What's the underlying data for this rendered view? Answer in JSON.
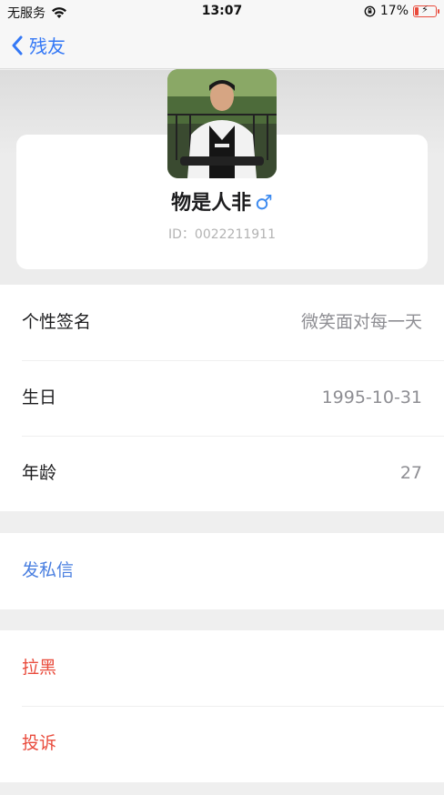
{
  "status_bar": {
    "carrier": "无服务",
    "time": "13:07",
    "battery": "17%",
    "battery_level": 0.17
  },
  "nav": {
    "back_label": "残友"
  },
  "profile": {
    "name": "物是人非",
    "gender_symbol": "♂",
    "id_text": "ID：0022211911"
  },
  "info_rows": [
    {
      "label": "个性签名",
      "value": "微笑面对每一天"
    },
    {
      "label": "生日",
      "value": "1995-10-31"
    },
    {
      "label": "年龄",
      "value": "27"
    }
  ],
  "actions": {
    "message": "发私信",
    "block": "拉黑",
    "report": "投诉"
  },
  "colors": {
    "link_blue": "#4a7fe0",
    "danger_red": "#e94b3c",
    "ios_blue": "#3478f6"
  }
}
